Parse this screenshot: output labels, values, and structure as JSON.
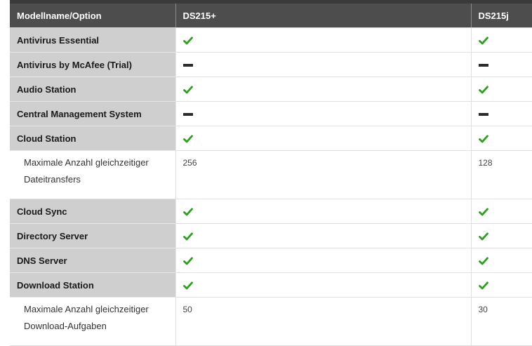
{
  "header": {
    "col_feature": "Modellname/Option",
    "col_model_a": "DS215+",
    "col_model_b": "DS215j"
  },
  "rows": [
    {
      "label": "Antivirus Essential",
      "a": "check",
      "b": "check"
    },
    {
      "label": "Antivirus by McAfee (Trial)",
      "a": "dash",
      "b": "dash"
    },
    {
      "label": "Audio Station",
      "a": "check",
      "b": "check"
    },
    {
      "label": "Central Management System",
      "a": "dash",
      "b": "dash"
    },
    {
      "label": "Cloud Station",
      "a": "check",
      "b": "check"
    },
    {
      "label": "Maximale Anzahl gleichzeitiger Dateitransfers",
      "a": "256",
      "b": "128",
      "sub": true
    },
    {
      "label": "Cloud Sync",
      "a": "check",
      "b": "check"
    },
    {
      "label": "Directory Server",
      "a": "check",
      "b": "check"
    },
    {
      "label": "DNS Server",
      "a": "check",
      "b": "check"
    },
    {
      "label": "Download Station",
      "a": "check",
      "b": "check"
    },
    {
      "label": "Maximale Anzahl gleichzeitiger Download-Aufgaben",
      "a": "50",
      "b": "30",
      "sub": true
    }
  ],
  "icons": {
    "check": "check-icon",
    "dash": "dash-icon"
  },
  "colors": {
    "header_bg": "#4d4d4d",
    "feature_bg": "#cfcfcf",
    "check": "#2e9e1f",
    "dash": "#2b2b2b"
  }
}
